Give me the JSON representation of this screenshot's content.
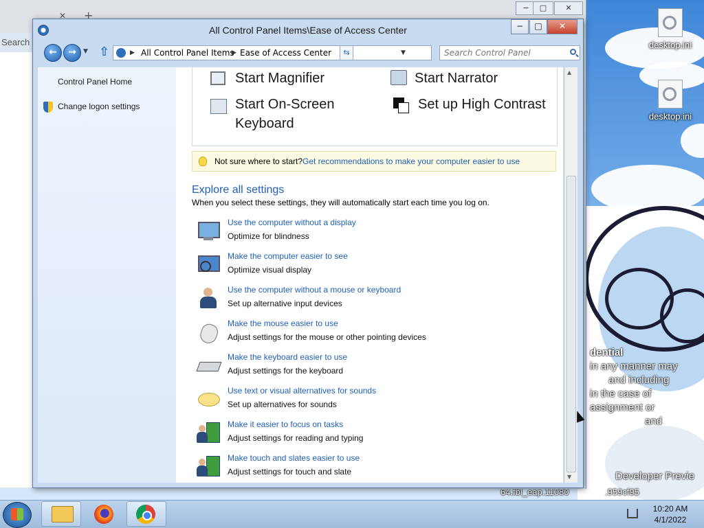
{
  "window": {
    "title": "All Control Panel Items\\Ease of Access Center",
    "minimize": "−",
    "maximize": "□",
    "close": "✕"
  },
  "address": {
    "segments": [
      "All Control Panel Items",
      "Ease of Access Center"
    ],
    "search_placeholder": "Search Control Panel"
  },
  "sidebar": {
    "home": "Control Panel Home",
    "logon": "Change logon settings"
  },
  "quick_access": {
    "magnifier": "Start Magnifier",
    "narrator": "Start Narrator",
    "osk_line1": "Start On-Screen",
    "osk_line2": "Keyboard",
    "contrast": "Set up High Contrast"
  },
  "tip": {
    "prefix": "Not sure where to start?",
    "link": "Get recommendations to make your computer easier to use"
  },
  "explore": {
    "heading": "Explore all settings",
    "subtitle": "When you select these settings, they will automatically start each time you log on.",
    "items": [
      {
        "title": "Use the computer without a display",
        "desc": "Optimize for blindness"
      },
      {
        "title": "Make the computer easier to see",
        "desc": "Optimize visual display"
      },
      {
        "title": "Use the computer without a mouse or keyboard",
        "desc": "Set up alternative input devices"
      },
      {
        "title": "Make the mouse easier to use",
        "desc": "Adjust settings for the mouse or other pointing devices"
      },
      {
        "title": "Make the keyboard easier to use",
        "desc": "Adjust settings for the keyboard"
      },
      {
        "title": "Use text or visual alternatives for sounds",
        "desc": "Set up alternatives for sounds"
      },
      {
        "title": "Make it easier to focus on tasks",
        "desc": "Adjust settings for reading and typing"
      },
      {
        "title": "Make touch and slates easier to use",
        "desc": "Adjust settings for touch and slate"
      }
    ]
  },
  "background_window": {
    "search_text": "Search"
  },
  "desktop": {
    "icons": [
      "desktop.ini",
      "desktop.ini"
    ],
    "watermark_lines": [
      "dential",
      "in any manner may",
      "and including",
      "in the case of",
      "assignment or",
      "and",
      "Developer Previe",
      "64.fbl_eap.11080",
      ".959cf95"
    ]
  },
  "taskbar": {
    "time": "10:20 AM",
    "date": "4/1/2022"
  }
}
